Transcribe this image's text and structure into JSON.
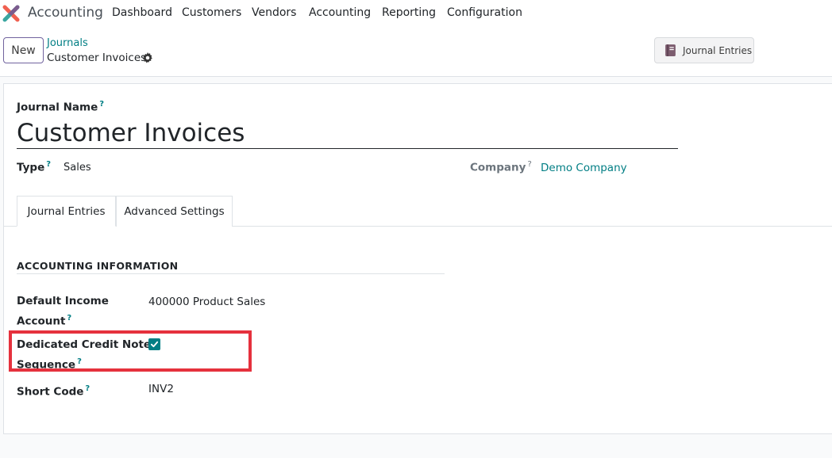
{
  "navbar": {
    "app_name": "Accounting",
    "menu": [
      "Dashboard",
      "Customers",
      "Vendors",
      "Accounting",
      "Reporting",
      "Configuration"
    ]
  },
  "control_panel": {
    "new_label": "New",
    "breadcrumb_parent": "Journals",
    "breadcrumb_current": "Customer Invoices",
    "journal_entries_button": "Journal Entries"
  },
  "form": {
    "journal_name_label": "Journal Name",
    "journal_name": "Customer Invoices",
    "type_label": "Type",
    "type_value": "Sales",
    "company_label": "Company",
    "company_value": "Demo Company",
    "help_mark": "?",
    "tabs": [
      "Journal Entries",
      "Advanced Settings"
    ],
    "section_title": "ACCOUNTING INFORMATION",
    "default_income_label_1": "Default Income",
    "default_income_label_2": "Account",
    "default_income_value": "400000 Product Sales",
    "credit_note_label_1": "Dedicated Credit Note",
    "credit_note_label_2": "Sequence",
    "credit_note_checked": true,
    "short_code_label": "Short Code",
    "short_code_value": "INV2"
  },
  "colors": {
    "accent": "#017e84",
    "primary": "#71639e",
    "highlight": "#e5313d"
  }
}
